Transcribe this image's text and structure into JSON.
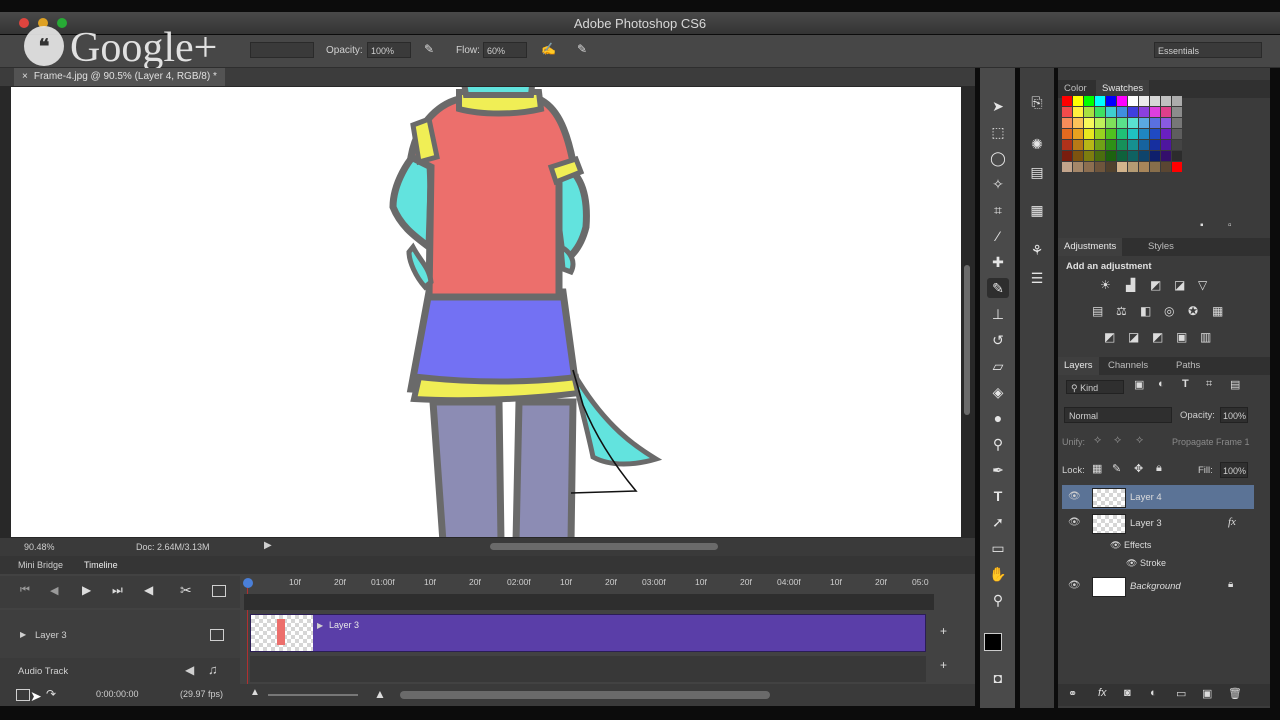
{
  "app": {
    "title": "Adobe Photoshop CS6"
  },
  "overlay": {
    "google_plus": "Google+",
    "hangout_glyph": "❝"
  },
  "options": {
    "opacity_label": "Opacity:",
    "opacity_value": "100%",
    "flow_label": "Flow:",
    "flow_value": "60%",
    "workspace": "Essentials"
  },
  "document": {
    "tab_label": "Frame-4.jpg @ 90.5% (Layer 4, RGB/8) *"
  },
  "status": {
    "zoom": "90.48%",
    "doc_size": "Doc: 2.64M/3.13M"
  },
  "timeline": {
    "tabs": [
      "Mini Bridge",
      "Timeline"
    ],
    "ruler": [
      "10f",
      "20f",
      "01:00f",
      "10f",
      "20f",
      "02:00f",
      "10f",
      "20f",
      "03:00f",
      "10f",
      "20f",
      "04:00f",
      "10f",
      "20f",
      "05:0"
    ],
    "tracks": {
      "layer3": "Layer 3",
      "audio": "Audio Track"
    },
    "clip_label": "Layer 3",
    "timecode": "0:00:00:00",
    "fps": "(29.97 fps)"
  },
  "panels": {
    "color_tabs": [
      "Color",
      "Swatches"
    ],
    "adjust_tabs": [
      "Adjustments",
      "Styles"
    ],
    "add_adjustment": "Add an adjustment",
    "layers_tabs": [
      "Layers",
      "Channels",
      "Paths"
    ],
    "kind": "Kind",
    "blend_mode": "Normal",
    "opacity_label": "Opacity:",
    "opacity_value": "100%",
    "unify_label": "Unify:",
    "propagate": "Propagate Frame 1",
    "lock_label": "Lock:",
    "fill_label": "Fill:",
    "fill_value": "100%",
    "layers": [
      {
        "name": "Layer 4"
      },
      {
        "name": "Layer 3",
        "fx": "fx",
        "effects": "Effects",
        "stroke": "Stroke"
      },
      {
        "name": "Background"
      }
    ]
  },
  "colors": {
    "accent": "#5a3ea8",
    "selected_layer": "#5b7396",
    "shirt": "#ec6f6c",
    "skirt": "#7371f3",
    "trim": "#f0ee55",
    "skin": "#62e3de",
    "legs": "#8c8cb4",
    "outline": "#6a6a6a"
  },
  "swatches": [
    [
      "#ff0000",
      "#ffff00",
      "#00ff00",
      "#00ffff",
      "#0000ff",
      "#ff00ff",
      "#ffffff",
      "#ebebeb",
      "#d6d6d6",
      "#c0c0c0",
      "#acacac"
    ],
    [
      "#f24b4b",
      "#ffef3f",
      "#a8e040",
      "#3ee061",
      "#3ecfcf",
      "#3f8fde",
      "#3f3fde",
      "#8b3fde",
      "#de3fde",
      "#de3f8b",
      "#8c8c8c"
    ],
    [
      "#f58c5a",
      "#fbc25a",
      "#f8f85a",
      "#bff05a",
      "#7fe05a",
      "#5ae08a",
      "#5ae0d0",
      "#5aa8e0",
      "#5a70e0",
      "#8a5ae0",
      "#777777"
    ],
    [
      "#e26a1f",
      "#e8a21f",
      "#e8e81f",
      "#97d21f",
      "#4fc21f",
      "#1fc276",
      "#1fc2c2",
      "#1f86c2",
      "#1f4ac2",
      "#6a1fc2",
      "#5e5e5e"
    ],
    [
      "#b0321a",
      "#b77a16",
      "#b7b716",
      "#6fa016",
      "#2e9016",
      "#16905a",
      "#169090",
      "#16639f",
      "#162f9f",
      "#4e169f",
      "#444444"
    ],
    [
      "#7a1d0e",
      "#7d530f",
      "#7d7d0f",
      "#4a6d0f",
      "#1d620f",
      "#0f623c",
      "#0f6262",
      "#0f446c",
      "#0f1f6c",
      "#340f6c",
      "#2c2c2c"
    ],
    [
      "#c3a58c",
      "#a58769",
      "#8c6e50",
      "#6e553c",
      "#50412d",
      "#d2b48c",
      "#b49b73",
      "#a8865a",
      "#876e4b",
      "#5a4632",
      "#ff0000"
    ]
  ]
}
